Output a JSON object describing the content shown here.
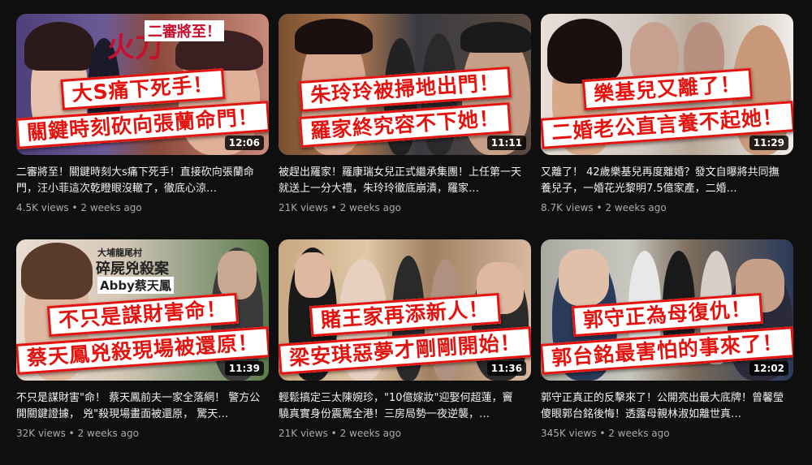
{
  "videos": [
    {
      "banner1": "大S痛下死手！",
      "banner2": "關鍵時刻砍向張蘭命門！",
      "overlay": "二審將至！",
      "overlay2": "火刀",
      "duration": "12:06",
      "title": "二審將至！關鍵時刻大s痛下死手！直接砍向張蘭命門，汪小菲這次乾瞪眼沒轍了，徹底心涼…",
      "views": "4.5K views",
      "age": "2 weeks ago",
      "colors": {
        "bg1": "#5a4a8a",
        "bg2": "#d9a08a"
      }
    },
    {
      "banner1": "朱玲玲被掃地出門！",
      "banner2": "羅家終究容不下她！",
      "duration": "11:11",
      "title": "被趕出羅家！羅康瑞女兒正式繼承集團！上任第一天就送上一分大禮，朱玲玲徹底崩潰，羅家…",
      "views": "21K views",
      "age": "2 weeks ago",
      "colors": {
        "bg1": "#8a5a3a",
        "bg2": "#3a3a3a"
      }
    },
    {
      "banner1": "樂基兒又離了！",
      "banner2": "二婚老公直言養不起她！",
      "duration": "11:29",
      "title": "又離了！ 42歲樂基兒再度離婚？發文自曝將共同撫養兒子，一婚花光黎明7.5億家產，二婚…",
      "views": "8.7K views",
      "age": "2 weeks ago",
      "colors": {
        "bg1": "#d8d0c8",
        "bg2": "#9a8a7a"
      }
    },
    {
      "banner1": "不只是謀財害命！",
      "banner2": "蔡天鳳兇殺現場被還原！",
      "overlay": "碎屍兇殺案",
      "overlay2": "Abby蔡天鳳",
      "overlay3": "大埔龍尾村",
      "duration": "11:39",
      "title": "不只是謀財害\"命！ 蔡天鳳前夫一家全落網！ 警方公開關鍵證據， 兇\"殺現場畫面被還原， 驚天…",
      "views": "32K views",
      "age": "2 weeks ago",
      "colors": {
        "bg1": "#c8b8a8",
        "bg2": "#6a8a5a"
      }
    },
    {
      "banner1": "賭王家再添新人！",
      "banner2": "梁安琪惡夢才剛剛開始！",
      "duration": "11:36",
      "title": "輕鬆搞定三太陳婉珍，\"10億嫁妝\"迎娶何超蓮，竇驍真實身份震驚全港！三房局勢一夜逆襲，…",
      "views": "21K views",
      "age": "2 weeks ago",
      "colors": {
        "bg1": "#d8c8a8",
        "bg2": "#8a6a4a"
      }
    },
    {
      "banner1": "郭守正為母復仇！",
      "banner2": "郭台銘最害怕的事來了！",
      "duration": "12:02",
      "title": "郭守正真正的反擊來了！公開亮出最大底牌！曾馨瑩傻眼郭台銘後悔！透露母親林淑如離世真…",
      "views": "345K views",
      "age": "2 weeks ago",
      "colors": {
        "bg1": "#b8b8b0",
        "bg2": "#3a4a6a"
      }
    }
  ]
}
